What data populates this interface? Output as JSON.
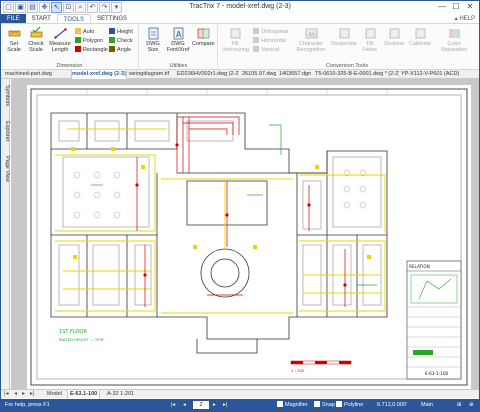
{
  "app": {
    "title": "TracTrix 7 - model-xref.dwg (2-3)"
  },
  "window": {
    "minimize": "—",
    "maximize": "☐",
    "close": "✕"
  },
  "ribbon_tabs": [
    {
      "label": "FILE"
    },
    {
      "label": "START"
    },
    {
      "label": "TOOLS"
    },
    {
      "label": "SETTINGS"
    }
  ],
  "help_label": "HELP",
  "ribbon": {
    "set_scale": "Set Scale",
    "check_scale": "Check Scale",
    "measure_length": "Measure Length",
    "auto": "Auto",
    "polygon": "Polygon",
    "rectangle": "Rectangle",
    "height": "Height",
    "check": "Check",
    "angle": "Angle",
    "dimension_group": "Dimension",
    "dwg_size": "DWG Size",
    "dwg_font": "DWG Font/Xref",
    "compare": "Compare",
    "utilities_group": "Utilities",
    "fill_vectorizing": "Fill Vectorizing",
    "orthogonal": "Orthogonal",
    "horizontal": "Horizontal",
    "vertical": "Vertical",
    "character_recognition": "Character Recognition",
    "despeckle": "Despeckle",
    "fill_holes": "Fill Holes",
    "deskew": "Deskew",
    "calibrate": "Calibrate",
    "color_separation": "Color Separation",
    "conversion_group": "Conversion Tools"
  },
  "doc_tabs": [
    {
      "label": "machined-part.dwg"
    },
    {
      "label": "model-xref.dwg (2-3)"
    },
    {
      "label": "wiringdiagram.tif"
    },
    {
      "label": "ED236HV002r1.dwg (2-2)"
    },
    {
      "label": "26105.97.dwg"
    },
    {
      "label": "1463657.dgn"
    },
    {
      "label": "T5-0610-325-B-E-0001.dwg * (2-2)"
    },
    {
      "label": "YP-X112-V-P601 (ACD)"
    }
  ],
  "side_tabs": [
    {
      "label": "Symbols"
    },
    {
      "label": "Explorer"
    },
    {
      "label": "Page View"
    }
  ],
  "drawing": {
    "legend_floor": "1ST FLOOR",
    "legend_sub": "RAISED HEIGHT — TFNF",
    "title_relation": "RELATION",
    "sheet_no": "E-63-1-100",
    "scale_note": "1 : 200"
  },
  "layout_tabs": [
    {
      "label": "Model"
    },
    {
      "label": "E-63.1-100"
    },
    {
      "label": "A-32 1-201"
    }
  ],
  "status": {
    "help_text": "For help, press F1",
    "page": "2",
    "magnifier": "Magnifier",
    "snap": "Snap",
    "polyline": "Polyline",
    "coords": "6.712,0.000'",
    "layer": "Main"
  },
  "colors": {
    "accent": "#2b579a",
    "drawing_yellow": "#e6d800",
    "drawing_red": "#d40000",
    "drawing_green": "#2aa52a"
  }
}
